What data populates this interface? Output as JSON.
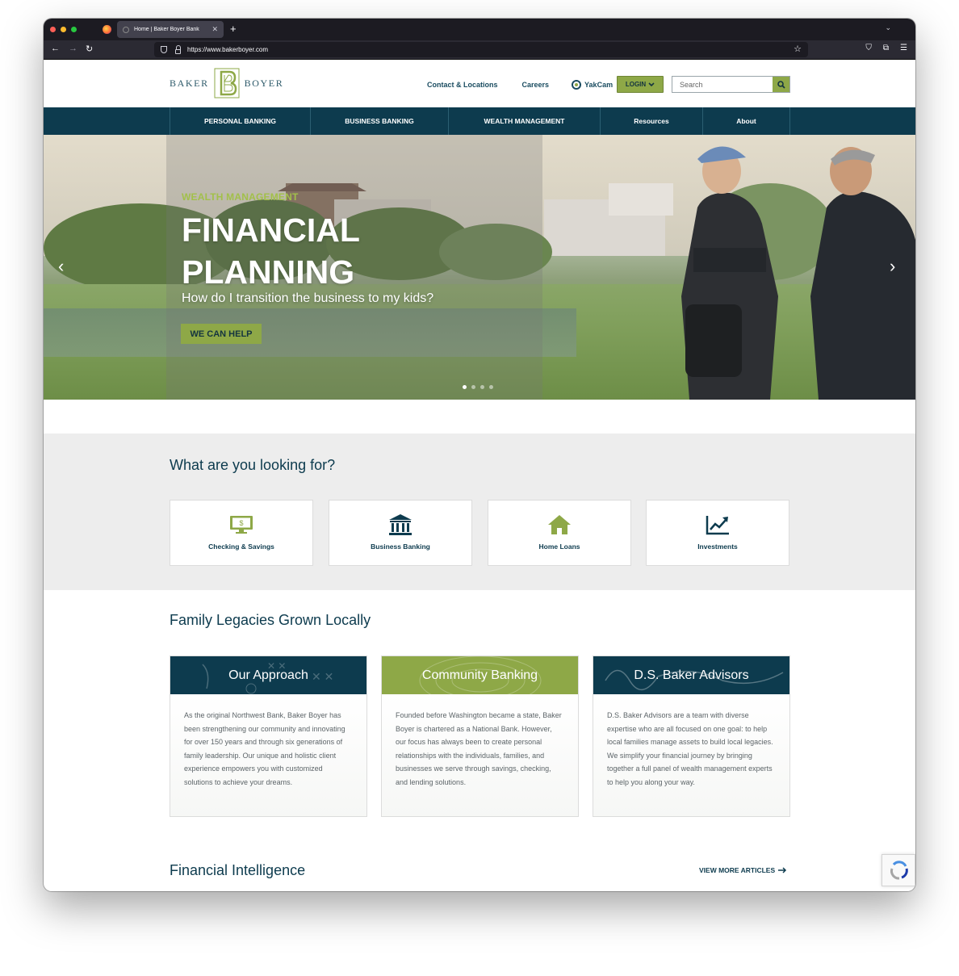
{
  "browser": {
    "tab_title": "Home | Baker Boyer Bank",
    "url": "https://www.bakerboyer.com"
  },
  "header": {
    "logo_left": "BAKER",
    "logo_right": "BOYER",
    "links": {
      "contact": "Contact & Locations",
      "careers": "Careers",
      "yakcam": "YakCam"
    },
    "login_label": "LOGIN",
    "search_placeholder": "Search"
  },
  "nav": {
    "items": [
      {
        "label": "PERSONAL BANKING"
      },
      {
        "label": "BUSINESS BANKING"
      },
      {
        "label": "WEALTH MANAGEMENT"
      },
      {
        "label": "Resources"
      },
      {
        "label": "About"
      }
    ]
  },
  "hero": {
    "eyebrow": "WEALTH MANAGEMENT",
    "title_line1": "FINANCIAL",
    "title_line2": "PLANNING",
    "subtitle": "How do I transition the business to my kids?",
    "cta": "WE CAN HELP",
    "slide_count": 4,
    "active_slide": 1
  },
  "looking": {
    "heading": "What are you looking for?",
    "cards": [
      {
        "label": "Checking & Savings",
        "icon": "monitor-dollar-icon"
      },
      {
        "label": "Business Banking",
        "icon": "bank-building-icon"
      },
      {
        "label": "Home Loans",
        "icon": "house-icon"
      },
      {
        "label": "Investments",
        "icon": "chart-trend-icon"
      }
    ]
  },
  "legacies": {
    "heading": "Family Legacies Grown Locally",
    "cards": [
      {
        "title": "Our Approach",
        "color": "#0d3b4e",
        "text": "As the original Northwest Bank, Baker Boyer has been strengthening our community and innovating for over 150 years and through six generations of family leadership. Our unique and holistic client experience empowers you with customized solutions to achieve your dreams."
      },
      {
        "title": "Community Banking",
        "color": "#8ea847",
        "text": "Founded before Washington became a state, Baker Boyer is chartered as a National Bank. However, our focus has always been to create personal relationships with the individuals, families, and businesses we serve through savings, checking, and lending solutions."
      },
      {
        "title": "D.S. Baker Advisors",
        "color": "#0d3b4e",
        "text": "D.S. Baker Advisors are a team with diverse expertise who are all focused on one goal: to help local families manage assets to build local legacies. We simplify your financial journey by bringing together a full panel of wealth management experts to help you along your way."
      }
    ]
  },
  "intelligence": {
    "heading": "Financial Intelligence",
    "link": "VIEW MORE ARTICLES"
  },
  "colors": {
    "navy": "#0d3b4e",
    "green": "#8ea847"
  }
}
